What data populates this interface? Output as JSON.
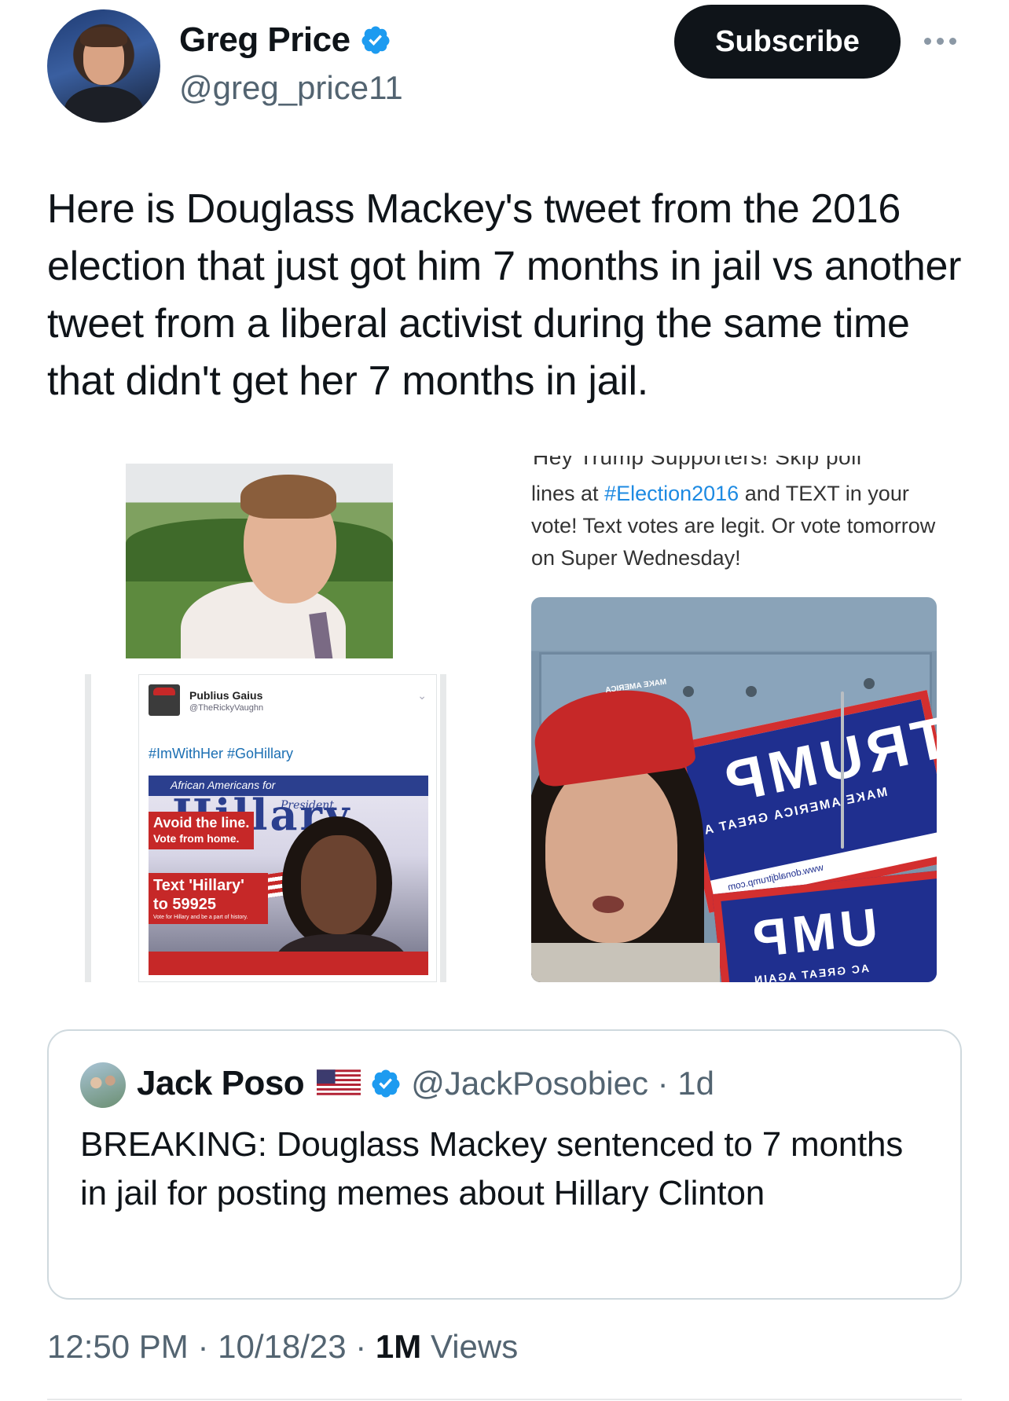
{
  "author": {
    "display_name": "Greg Price",
    "handle": "@greg_price11",
    "verified": true,
    "avatar_icon": "profile-photo"
  },
  "actions": {
    "subscribe_label": "Subscribe",
    "more_icon": "more-horizontal-icon"
  },
  "tweet": {
    "text": "Here is Douglass Mackey's tweet from the 2016 election that just got him 7 months in jail vs another tweet from a liberal activist during the same time that didn't get her 7 months in jail."
  },
  "media_left": {
    "embedded_tweet": {
      "name": "Publius Gaius",
      "handle": "@TheRickyVaughn",
      "hashtags": "#ImWithHer #GoHillary",
      "image": {
        "banner": "African Americans for",
        "headline": "Hillary",
        "subtitle": "President",
        "avoid_line_1": "Avoid the line.",
        "avoid_line_2": "Vote from home.",
        "text_line_1": "Text 'Hillary'",
        "text_line_2": "to 59925",
        "fine_print": "Vote for Hillary and be a part of history."
      }
    }
  },
  "media_right": {
    "clipped_line": "Hey Trump Supporters! Skip poll",
    "text_before_tag": "lines at ",
    "hashtag": "#Election2016",
    "text_after_tag": " and TEXT in your vote! Text votes are legit. Or vote tomorrow on Super Wednesday!",
    "photo": {
      "sign_word": "TRUMP",
      "sign_sub": "MAKE AMERICA GREAT A",
      "sign_url": "www.donaldjtrump.com",
      "sign2_word": "UMP",
      "sign2_sub": "AC GREAT AGAIN",
      "cap_text": "MAKE AMERICA"
    }
  },
  "quote": {
    "display_name": "Jack Poso",
    "flag_icon": "us-flag-icon",
    "verified": true,
    "handle_time": "@JackPosobiec · 1d",
    "text": "BREAKING: Douglass Mackey sentenced to 7 months in jail for posting memes about Hillary Clinton"
  },
  "meta": {
    "timestamp": "12:50 PM · 10/18/23 · ",
    "views_count": "1M",
    "views_label": " Views"
  },
  "colors": {
    "text": "#0f1419",
    "secondary": "#536471",
    "verified_blue": "#1d9bf0",
    "subscribe_bg": "#0f1419",
    "border": "#cfd9de"
  }
}
